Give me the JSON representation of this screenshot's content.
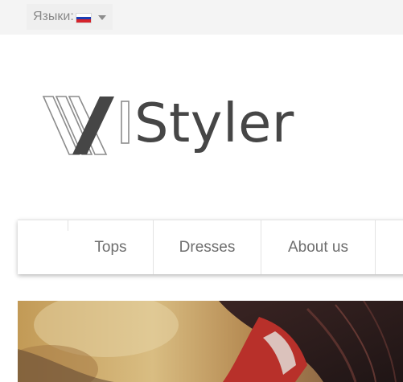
{
  "header": {
    "language_label": "Языки:",
    "current_language_flag": "ru-flag-icon",
    "dropdown_icon": "caret-down-icon"
  },
  "logo": {
    "icon": "styler-w-logo-icon",
    "text": "Styler",
    "colors": {
      "dark": "#464646",
      "outline": "#8c8c8c"
    }
  },
  "nav": {
    "items": [
      {
        "label": "Tops"
      },
      {
        "label": "Dresses"
      },
      {
        "label": "About us"
      }
    ]
  },
  "hero": {
    "image": "fashion-model-photo",
    "colors": {
      "warm": "#c9a25c",
      "red": "#b8302a",
      "dark": "#2b1e1e"
    }
  }
}
